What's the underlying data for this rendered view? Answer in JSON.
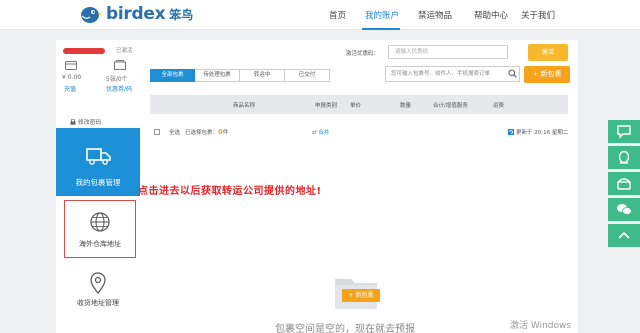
{
  "header": {
    "brand": "birdex",
    "brand_cn": "笨鸟",
    "nav": [
      {
        "label": "首页"
      },
      {
        "label": "我的账户"
      },
      {
        "label": "禁运物品"
      },
      {
        "label": "帮助中心"
      },
      {
        "label": "关于我们"
      }
    ],
    "active_nav": "我的账户",
    "colors": {
      "accent": "#1e88d2",
      "brand": "#2a6fa8"
    }
  },
  "sidebar": {
    "level_label": "已激活",
    "stats": [
      {
        "value": "¥ 0.00",
        "link": "充值",
        "icon": "wallet-icon"
      },
      {
        "value": "5张/0个",
        "link": "优惠券/码",
        "icon": "coupon-icon"
      }
    ],
    "change_password": "修改密码",
    "items": [
      {
        "label": "我的包裹管理",
        "icon": "truck-icon"
      },
      {
        "label": "海外仓库地址",
        "icon": "globe-icon"
      },
      {
        "label": "收货地址管理",
        "icon": "location-pin-icon"
      }
    ]
  },
  "main": {
    "promo_label": "激活优惠码：",
    "promo_placeholder": "请输入优惠码",
    "promo_button": "激活",
    "tabs": [
      "全部包裹",
      "待处理包裹",
      "转运中",
      "已交付"
    ],
    "search_placeholder": "您可输入包裹号、收件人、手机搜索订单",
    "new_parcel_button": "+ 新包裹",
    "table_headers": [
      "商品名称",
      "申报类别",
      "单价",
      "数量",
      "合计/增值服务",
      "运费"
    ],
    "select_all": "全选",
    "selected_label": "已选择包裹：",
    "selected_count": "0",
    "selected_unit": "件",
    "merge_label": "合并",
    "update_time": "更新于 20:16 星期二",
    "annotation": "点击进去以后获取转运公司提供的地址!",
    "empty_button": "+ 新包裹",
    "empty_text": "包裹空间是空的，现在就去预报"
  },
  "float_bar": [
    "chat-icon",
    "qq-icon",
    "phone-icon",
    "wechat-icon",
    "top-arrow-icon"
  ],
  "watermark": "激活 Windows"
}
